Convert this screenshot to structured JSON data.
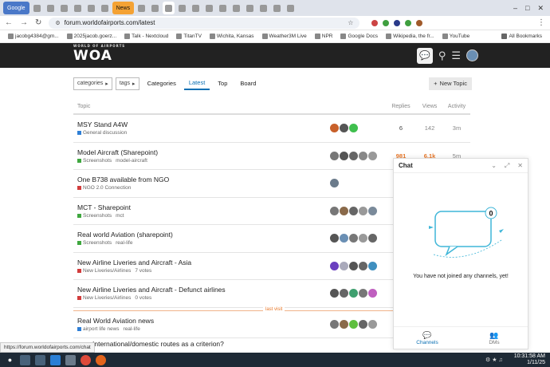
{
  "browser": {
    "tabs": [
      {
        "label": "Google",
        "type": "google"
      },
      {
        "label": "",
        "type": "fav"
      },
      {
        "label": "",
        "type": "fav"
      },
      {
        "label": "",
        "type": "fav"
      },
      {
        "label": "",
        "type": "fav"
      },
      {
        "label": "",
        "type": "fav"
      },
      {
        "label": "",
        "type": "fav"
      },
      {
        "label": "News",
        "type": "news"
      },
      {
        "label": "",
        "type": "fav"
      },
      {
        "label": "",
        "type": "fav"
      },
      {
        "label": "",
        "type": "active"
      },
      {
        "label": "",
        "type": "fav"
      },
      {
        "label": "",
        "type": "fav"
      },
      {
        "label": "",
        "type": "fav"
      },
      {
        "label": "",
        "type": "fav"
      },
      {
        "label": "",
        "type": "fav"
      },
      {
        "label": "",
        "type": "fav"
      },
      {
        "label": "",
        "type": "fav"
      },
      {
        "label": "",
        "type": "fav"
      },
      {
        "label": "",
        "type": "fav"
      }
    ],
    "url": "forum.worldofairports.com/latest",
    "bookmarks": [
      "jacobg4384@gm...",
      "2025jacob.goerz...",
      "Talk - Nextcloud",
      "TitanTV",
      "Wichita, Kansas",
      "Weather3M Live",
      "NPR",
      "Google Docs",
      "Wikipedia, the fr...",
      "YouTube"
    ],
    "all_bookmarks": "All Bookmarks"
  },
  "site": {
    "logo_small": "WORLD OF AIRPORTS",
    "logo": "WOA"
  },
  "filters": {
    "categories": "categories",
    "tags": "tags",
    "nav": [
      "Categories",
      "Latest",
      "Top",
      "Board"
    ],
    "active_nav": "Latest",
    "new_topic": "New Topic"
  },
  "table": {
    "headers": {
      "topic": "Topic",
      "replies": "Replies",
      "views": "Views",
      "activity": "Activity"
    },
    "rows": [
      {
        "title": "MSY Stand A4W",
        "category": "General discussion",
        "cat_color": "#2f7fd6",
        "tags": "",
        "replies": "6",
        "views": "142",
        "activity": "3m",
        "hot": false,
        "posters": [
          "#c8602a",
          "#555",
          "#3fbf4e"
        ]
      },
      {
        "title": "Model Aircraft (Sharepoint)",
        "category": "Screenshots",
        "cat_color": "#3fa73f",
        "tags": "model-aircraft",
        "replies": "981",
        "views": "6.1k",
        "activity": "5m",
        "hot": true,
        "posters": [
          "#777",
          "#555",
          "#666",
          "#888",
          "#999"
        ]
      },
      {
        "title": "One B738 available from NGO",
        "category": "NGO 2.0 Connection",
        "cat_color": "#d23c3c",
        "tags": "",
        "replies": "",
        "views": "",
        "activity": "",
        "hot": false,
        "posters": [
          "#6b7b8b"
        ]
      },
      {
        "title": "MCT - Sharepoint",
        "category": "Screenshots",
        "cat_color": "#3fa73f",
        "tags": "mct",
        "replies": "",
        "views": "",
        "activity": "",
        "hot": false,
        "posters": [
          "#777",
          "#8a6a4a",
          "#666",
          "#999",
          "#7a8a9a"
        ]
      },
      {
        "title": "Real world Aviation (sharepoint)",
        "category": "Screenshots",
        "cat_color": "#3fa73f",
        "tags": "real-life",
        "replies": "",
        "views": "",
        "activity": "",
        "hot": false,
        "posters": [
          "#555",
          "#6a8fb4",
          "#777",
          "#999",
          "#666"
        ]
      },
      {
        "title": "New Airline Liveries and Aircraft - Asia",
        "category": "New Liveries/Airlines",
        "cat_color": "#d23c3c",
        "tags": "7 votes",
        "replies": "",
        "views": "",
        "activity": "",
        "hot": false,
        "posters": [
          "#6a3fbf",
          "#aab",
          "#555",
          "#666",
          "#3f8fbf"
        ]
      },
      {
        "title": "New Airline Liveries and Aircraft - Defunct airlines",
        "category": "New Liveries/Airlines",
        "cat_color": "#d23c3c",
        "tags": "0 votes",
        "replies": "",
        "views": "",
        "activity": "",
        "hot": false,
        "posters": [
          "#555",
          "#666",
          "#3f9f6f",
          "#777",
          "#bf5fbf"
        ]
      },
      {
        "title": "Real World Aviation news",
        "category": "airport life news",
        "cat_color": "#2f7fd6",
        "tags": "real-life",
        "replies": "",
        "views": "",
        "activity": "",
        "hot": false,
        "posters": [
          "#777",
          "#8a6a4a",
          "#5fbf3f",
          "#666",
          "#999"
        ]
      }
    ],
    "last_visit": "last visit",
    "partial_next": "International/domestic routes as a criterion?"
  },
  "chat": {
    "title": "Chat",
    "badge_count": "0",
    "empty_message": "You have not joined any channels, yet!",
    "tabs": [
      {
        "label": "Channels",
        "icon": "chat-bubbles-icon"
      },
      {
        "label": "DMs",
        "icon": "people-icon"
      }
    ]
  },
  "status_url": "https://forum.worldofairports.com/chat",
  "taskbar": {
    "time": "10:31:58 AM",
    "date": "1/11/25"
  }
}
